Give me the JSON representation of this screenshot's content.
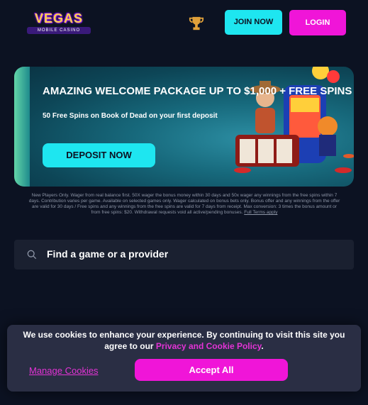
{
  "header": {
    "logo_text": "VEGAS",
    "logo_subtext": "MOBILE CASINO",
    "trophy_icon": "trophy-icon",
    "join_label": "JOIN NOW",
    "login_label": "LOGIN"
  },
  "banner": {
    "title": "AMAZING WELCOME PACKAGE UP TO $1,000 + FREE SPINS",
    "subtitle": "50 Free Spins on Book of Dead on your first deposit",
    "deposit_label": "DEPOSIT NOW"
  },
  "terms": {
    "text": "New Players Only. Wager from real balance first. 50X wager the bonus money within 30 days and 50x wager any winnings from the free spins within 7 days. Contribution varies per game. Available on selected games only. Wager calculated on bonus bets only. Bonus offer and any winnings from the offer are valid for 30 days / Free spins and any winnings from the free spins are valid for 7 days from receipt. Max conversion: 3 times the bonus amount or from free spins: $20. Withdrawal requests void all active/pending bonuses.",
    "link_label": "Full Terms apply"
  },
  "search": {
    "placeholder": "Find a game or a provider",
    "icon": "search-icon"
  },
  "cookie": {
    "text_before": "We use cookies to enhance your experience. By continuing to visit this site you agree to our ",
    "link_label": "Privacy and Cookie Policy",
    "text_after": ".",
    "manage_label": "Manage Cookies",
    "accept_label": "Accept All"
  },
  "colors": {
    "background": "#0c1222",
    "cyan": "#1ee6f0",
    "magenta": "#f015d8",
    "trophy": "#e0a03a"
  }
}
